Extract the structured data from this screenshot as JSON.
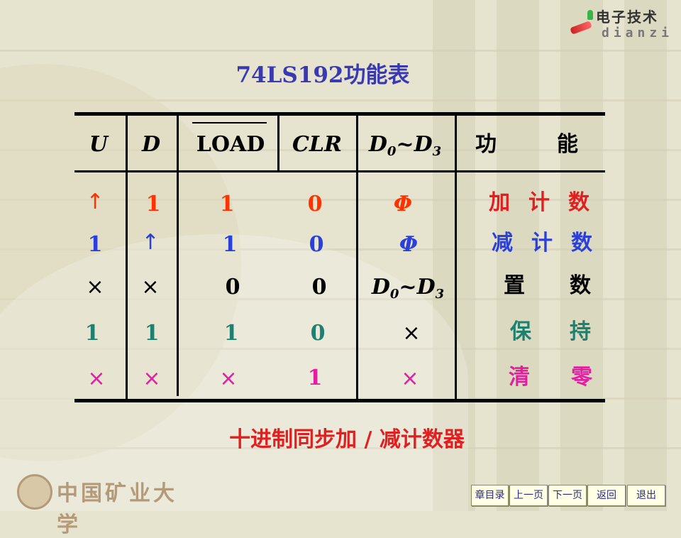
{
  "logo": {
    "cn": "电子技术",
    "en": "dianzi"
  },
  "title": "74LS192功能表",
  "headers": {
    "u": "U",
    "d": "D",
    "load": "LOAD",
    "clr": "CLR",
    "data_d": "D",
    "data_sub0": "0",
    "data_tilde": "~",
    "data_d3": "D",
    "data_sub3": "3",
    "func_a": "功",
    "func_b": "能"
  },
  "rows": [
    {
      "u": "↑",
      "d": "1",
      "load": "1",
      "clr": "0",
      "data": "Φ",
      "func_a": "加",
      "func_b": "计",
      "func_c": "数"
    },
    {
      "u": "1",
      "d": "↑",
      "load": "1",
      "clr": "0",
      "data": "Φ",
      "func_a": "减",
      "func_b": "计",
      "func_c": "数"
    },
    {
      "u": "×",
      "d": "×",
      "load": "0",
      "clr": "0",
      "data_d": "D",
      "data_sub0": "0",
      "data_tilde": "~",
      "data_d3": "D",
      "data_sub3": "3",
      "func_a": "置",
      "func_b": "数"
    },
    {
      "u": "1",
      "d": "1",
      "load": "1",
      "clr": "0",
      "data": "×",
      "func_a": "保",
      "func_b": "持"
    },
    {
      "u": "×",
      "d": "×",
      "load": "×",
      "clr": "1",
      "data": "×",
      "func_a": "清",
      "func_b": "零"
    }
  ],
  "caption": "十进制同步加 / 减计数器",
  "university": "中国矿业大学",
  "nav": {
    "toc": "章目录",
    "prev": "上一页",
    "next": "下一页",
    "back": "返回",
    "exit": "退出"
  },
  "colors": {
    "title": "#3a3ab0",
    "row1": "#ff3300",
    "row2": "#2a40d8",
    "row3": "#000000",
    "row4": "#208070",
    "row5": "#e020a0",
    "caption": "#e02020"
  }
}
